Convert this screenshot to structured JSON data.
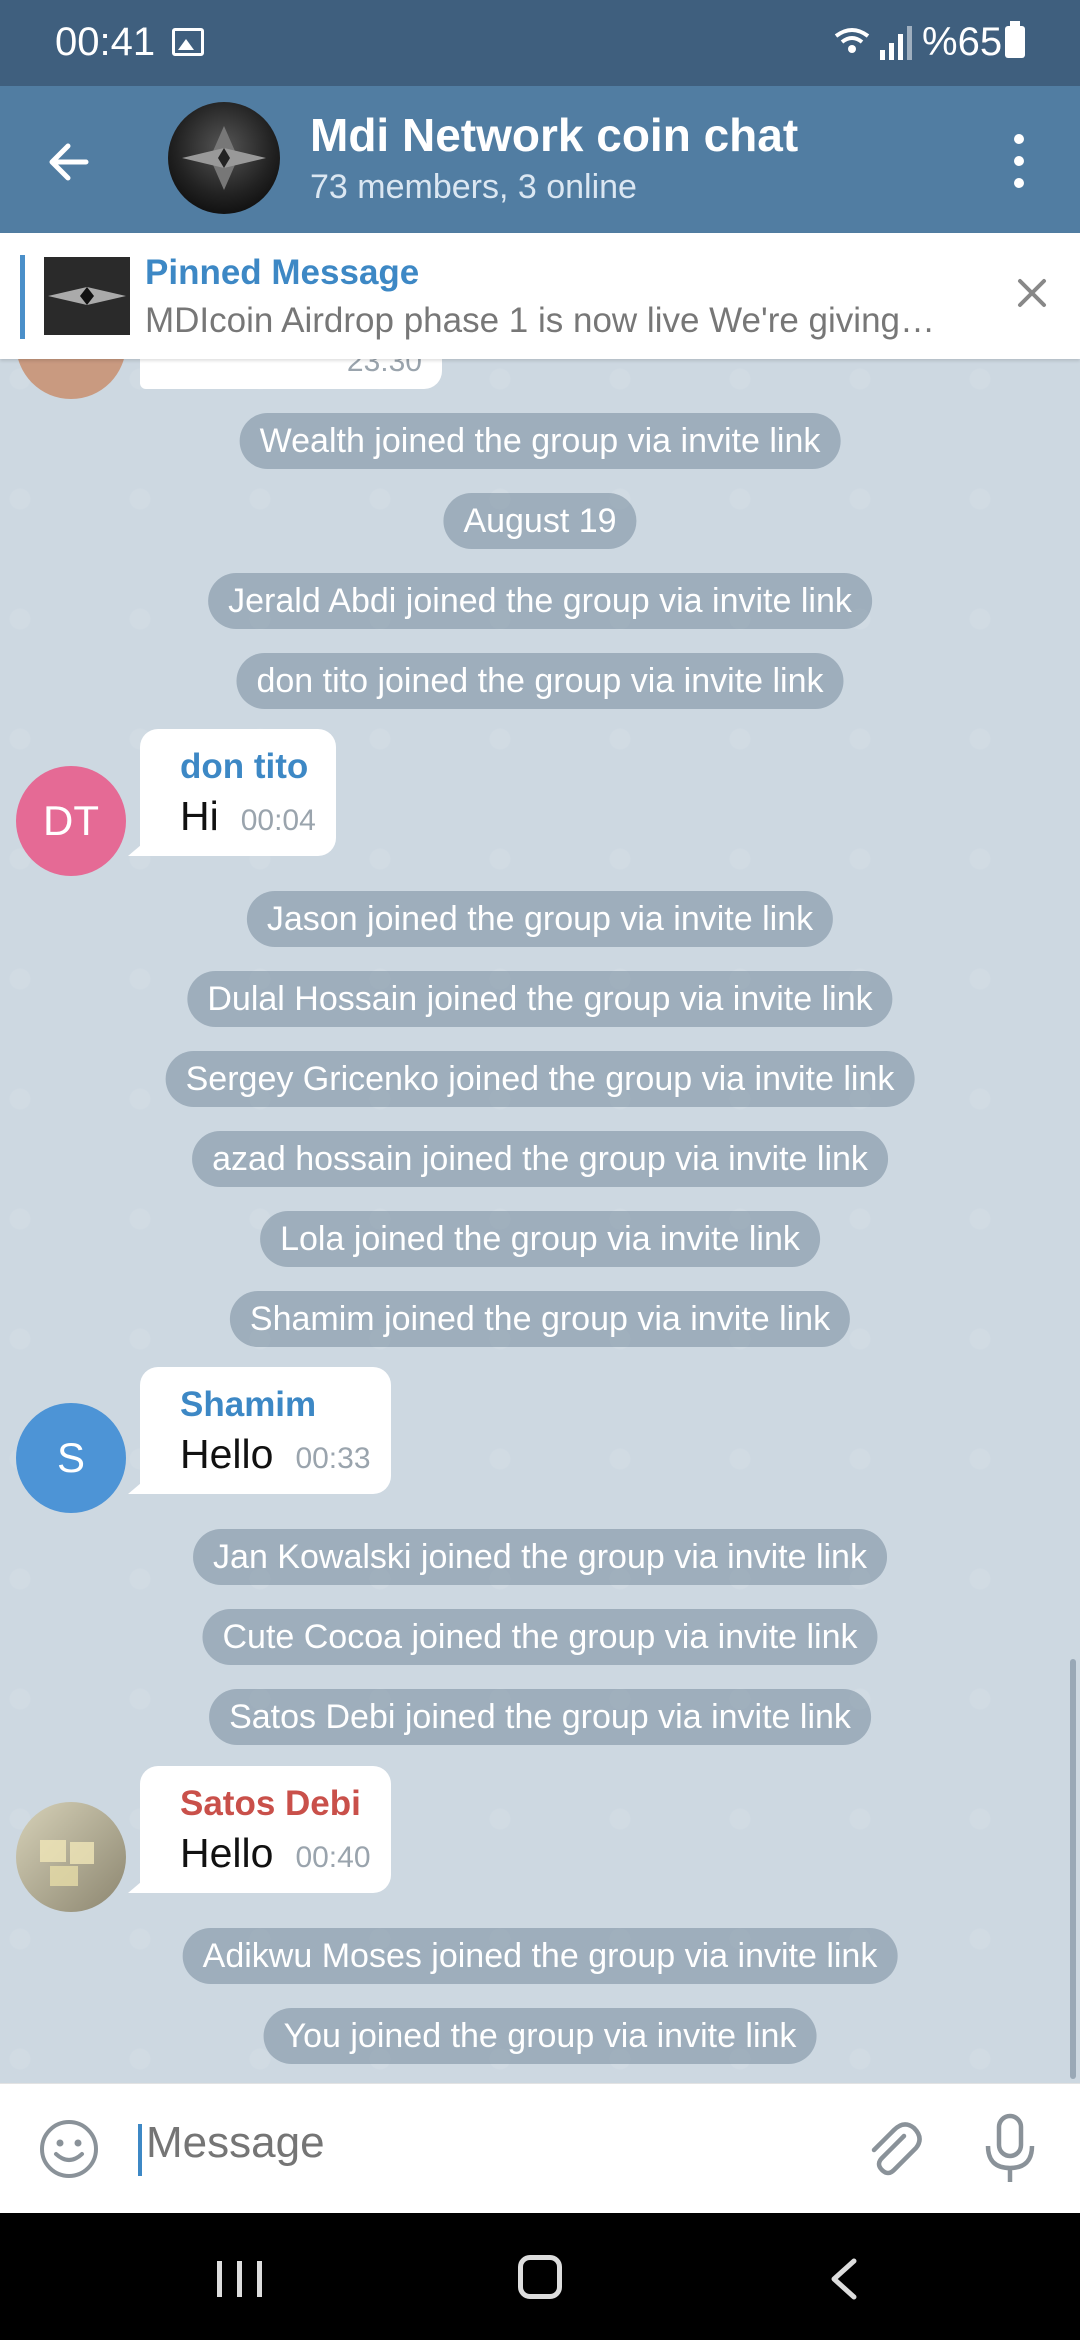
{
  "status_bar": {
    "time": "00:41",
    "battery": "%65"
  },
  "header": {
    "title": "Mdi Network coin chat",
    "subtitle": "73 members, 3 online"
  },
  "pinned": {
    "label": "Pinned Message",
    "text": "MDIcoin Airdrop phase 1 is now live We're giving…"
  },
  "partial_message": {
    "time": "23:30"
  },
  "services": [
    "Wealth joined the group via invite link",
    "August 19",
    "Jerald Abdi joined the group via invite link",
    "don tito joined the group via invite link",
    "Jason joined the group via invite link",
    "Dulal Hossain joined the group via invite link",
    "Sergey Gricenko joined the group via invite link",
    "azad hossain joined the group via invite link",
    "Lola joined the group via invite link",
    "Shamim joined the group via invite link",
    "Jan Kowalski joined the group via invite link",
    "Cute Cocoa joined the group via invite link",
    "Satos Debi joined the group via invite link",
    "Adikwu Moses joined the group via invite link",
    "You joined the group via invite link"
  ],
  "messages": [
    {
      "avatar_text": "DT",
      "avatar_color": "#e56a95",
      "sender": "don tito",
      "sender_color": "#3d88c5",
      "text": "Hi",
      "time": "00:04"
    },
    {
      "avatar_text": "S",
      "avatar_color": "#4d94d6",
      "sender": "Shamim",
      "sender_color": "#3d88c5",
      "text": "Hello",
      "time": "00:33"
    },
    {
      "avatar_text": "",
      "avatar_color": "#b8b39a",
      "sender": "Satos Debi",
      "sender_color": "#c9504a",
      "text": "Hello",
      "time": "00:40"
    }
  ],
  "input": {
    "placeholder": "Message"
  },
  "colors": {
    "header": "#517da2",
    "statusbar": "#3f5f7e",
    "accent": "#3d88c5"
  }
}
